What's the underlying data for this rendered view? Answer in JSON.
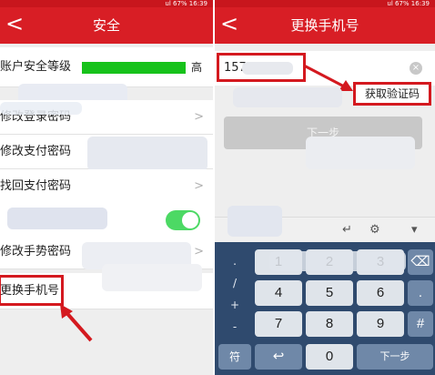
{
  "left": {
    "status": "ul 67% 16:39",
    "title": "安全",
    "back": "<",
    "rows": [
      {
        "label": "账户安全等级",
        "level_label": "高",
        "level": 1.0
      },
      {
        "label": "修改登录密码"
      },
      {
        "label": "修改支付密码"
      },
      {
        "label": "找回支付密码"
      },
      {
        "label": ""
      },
      {
        "label": "修改手势密码"
      },
      {
        "label": "更换手机号"
      }
    ],
    "chevron": ">"
  },
  "right": {
    "status": "ul 67% 16:39",
    "title": "更换手机号",
    "back": "<",
    "phone_prefix": "157",
    "clear_icon": "×",
    "get_code": "获取验证码",
    "next": "下一步",
    "keys": [
      "1",
      "2",
      "3",
      "4",
      "5",
      "6",
      "7",
      "8",
      "9",
      "0",
      "#"
    ],
    "side_symbols": [
      ".",
      "/",
      "+",
      "-"
    ],
    "bottom_left": "符",
    "bottom_right": "下一步",
    "toolbar_icons": [
      "gear-icon",
      "chevron-down-icon",
      "backspace-icon",
      "return-icon"
    ]
  },
  "colors": {
    "brand_red": "#d81e25",
    "level_green": "#17c21b",
    "toggle_green": "#4cd964",
    "highlight_red": "#d4191f",
    "keyboard_bg": "#2f4a6e"
  }
}
